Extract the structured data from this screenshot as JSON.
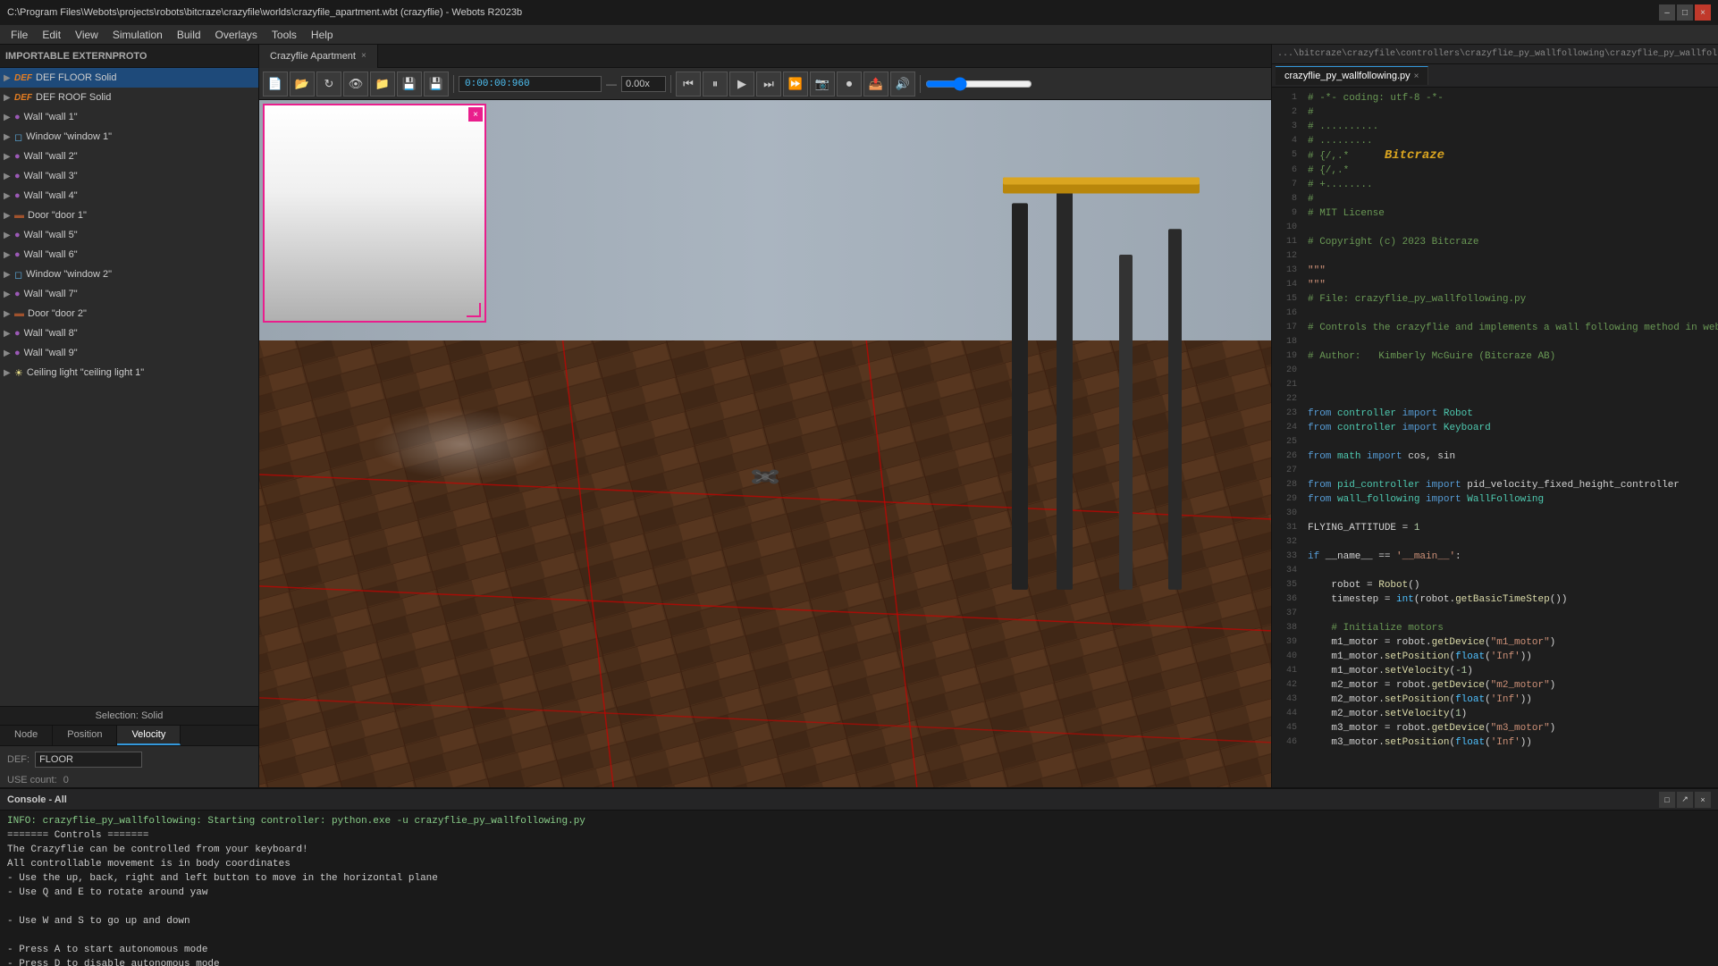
{
  "window": {
    "title": "C:\\Program Files\\Webots\\projects\\robots\\bitcraze\\crazyfile\\worlds\\crazyfile_apartment.wbt (crazyflie) - Webots R2023b"
  },
  "menu": {
    "items": [
      "File",
      "Edit",
      "View",
      "Simulation",
      "Build",
      "Overlays",
      "Tools",
      "Help"
    ]
  },
  "world_tab": {
    "label": "Crazyflie Apartment",
    "close_btn": "×"
  },
  "toolbar": {
    "time": "0:00:00:960",
    "separator": "—",
    "speed": "0.00x"
  },
  "scene_tree": {
    "header": "IMPORTABLE EXTERNPROTO",
    "items": [
      {
        "label": "DEF FLOOR Solid",
        "type": "def",
        "expanded": false
      },
      {
        "label": "DEF ROOF Solid",
        "type": "def",
        "expanded": false
      },
      {
        "label": "Wall \"wall 1\"",
        "type": "wall",
        "expanded": false
      },
      {
        "label": "Window \"window 1\"",
        "type": "window",
        "expanded": false
      },
      {
        "label": "Wall \"wall 2\"",
        "type": "wall",
        "expanded": false
      },
      {
        "label": "Wall \"wall 3\"",
        "type": "wall",
        "expanded": false
      },
      {
        "label": "Wall \"wall 4\"",
        "type": "wall",
        "expanded": false
      },
      {
        "label": "Door \"door 1\"",
        "type": "door",
        "expanded": false
      },
      {
        "label": "Wall \"wall 5\"",
        "type": "wall",
        "expanded": false
      },
      {
        "label": "Wall \"wall 6\"",
        "type": "wall",
        "expanded": false
      },
      {
        "label": "Window \"window 2\"",
        "type": "window",
        "expanded": false
      },
      {
        "label": "Wall \"wall 7\"",
        "type": "wall",
        "expanded": false
      },
      {
        "label": "Door \"door 2\"",
        "type": "door",
        "expanded": false
      },
      {
        "label": "Wall \"wall 8\"",
        "type": "wall",
        "expanded": false
      },
      {
        "label": "Wall \"wall 9\"",
        "type": "wall",
        "expanded": false
      },
      {
        "label": "Ceiling light \"ceiling light 1\"",
        "type": "ceiling",
        "expanded": false
      }
    ],
    "selected_index": 0
  },
  "selection_bar": {
    "text": "Selection: Solid"
  },
  "tabs": {
    "items": [
      "Node",
      "Position",
      "Velocity"
    ],
    "active": 2
  },
  "def_field": {
    "label": "DEF:",
    "value": "FLOOR",
    "use_count_label": "USE count:",
    "use_count_value": "0"
  },
  "editor": {
    "tab_label": "crazyflie_py_wallfollowing.py",
    "close_btn": "×",
    "path": "...\\bitcraze\\crazyfile\\controllers\\crazyflie_py_wallfollowing\\crazyflie_py_wallfollowing.py",
    "code_lines": [
      {
        "num": 1,
        "content": "# -*- coding: utf-8 -*-",
        "class": "kw-comment"
      },
      {
        "num": 2,
        "content": "#",
        "class": "kw-comment"
      },
      {
        "num": 3,
        "content": "# ..........",
        "class": "kw-comment"
      },
      {
        "num": 4,
        "content": "# .........",
        "class": "kw-comment"
      },
      {
        "num": 5,
        "content": "# {/,.*      Bitcraze",
        "class": "kw-comment"
      },
      {
        "num": 6,
        "content": "# {/,.*",
        "class": "kw-comment"
      },
      {
        "num": 7,
        "content": "# +........",
        "class": "kw-comment"
      },
      {
        "num": 8,
        "content": "#",
        "class": "kw-comment"
      },
      {
        "num": 9,
        "content": "# MIT License",
        "class": "kw-comment"
      },
      {
        "num": 10,
        "content": "",
        "class": ""
      },
      {
        "num": 11,
        "content": "# Copyright (c) 2023 Bitcraze",
        "class": "kw-comment"
      },
      {
        "num": 12,
        "content": "",
        "class": ""
      },
      {
        "num": 13,
        "content": "\"\"\"",
        "class": "kw-string"
      },
      {
        "num": 14,
        "content": "\"\"\"",
        "class": "kw-string"
      },
      {
        "num": 15,
        "content": "# File: crazyflie_py_wallfollowing.py",
        "class": "kw-comment"
      },
      {
        "num": 16,
        "content": "",
        "class": ""
      },
      {
        "num": 17,
        "content": "# Controls the crazyflie and implements a wall following method in webots in",
        "class": "kw-comment"
      },
      {
        "num": 18,
        "content": "",
        "class": ""
      },
      {
        "num": 19,
        "content": "# Author:   Kimberly McGuire (Bitcraze AB)",
        "class": "kw-comment"
      },
      {
        "num": 20,
        "content": "",
        "class": ""
      },
      {
        "num": 21,
        "content": "",
        "class": ""
      },
      {
        "num": 22,
        "content": "",
        "class": ""
      },
      {
        "num": 23,
        "content": "from controller import Robot",
        "class": ""
      },
      {
        "num": 24,
        "content": "from controller import Keyboard",
        "class": ""
      },
      {
        "num": 25,
        "content": "",
        "class": ""
      },
      {
        "num": 26,
        "content": "from math import cos, sin",
        "class": ""
      },
      {
        "num": 27,
        "content": "",
        "class": ""
      },
      {
        "num": 28,
        "content": "from pid_controller import pid_velocity_fixed_height_controller",
        "class": ""
      },
      {
        "num": 29,
        "content": "from wall_following import WallFollowing",
        "class": ""
      },
      {
        "num": 30,
        "content": "",
        "class": ""
      },
      {
        "num": 31,
        "content": "FLYING_ATTITUDE = 1",
        "class": ""
      },
      {
        "num": 32,
        "content": "",
        "class": ""
      },
      {
        "num": 33,
        "content": "if __name__ == '__main__':",
        "class": ""
      },
      {
        "num": 34,
        "content": "",
        "class": ""
      },
      {
        "num": 35,
        "content": "    robot = Robot()",
        "class": ""
      },
      {
        "num": 36,
        "content": "    timestep = int(robot.getBasicTimeStep())",
        "class": ""
      },
      {
        "num": 37,
        "content": "",
        "class": ""
      },
      {
        "num": 38,
        "content": "    # Initialize motors",
        "class": "kw-comment"
      },
      {
        "num": 39,
        "content": "    m1_motor = robot.getDevice(\"m1_motor\")",
        "class": ""
      },
      {
        "num": 40,
        "content": "    m1_motor.setPosition(float('Inf'))",
        "class": ""
      },
      {
        "num": 41,
        "content": "    m1_motor.setVelocity(-1)",
        "class": ""
      },
      {
        "num": 42,
        "content": "    m2_motor = robot.getDevice(\"m2_motor\")",
        "class": ""
      },
      {
        "num": 43,
        "content": "    m2_motor.setPosition(float('Inf'))",
        "class": ""
      },
      {
        "num": 44,
        "content": "    m2_motor.setVelocity(1)",
        "class": ""
      },
      {
        "num": 45,
        "content": "    m3_motor = robot.getDevice(\"m3_motor\")",
        "class": ""
      },
      {
        "num": 46,
        "content": "    m3_motor.setPosition(float('Inf'))",
        "class": ""
      }
    ]
  },
  "console": {
    "title": "Console - All",
    "lines": [
      {
        "text": "INFO: crazyflie_py_wallfollowing: Starting controller: python.exe -u crazyflie_py_wallfollowing.py",
        "class": "console-info"
      },
      {
        "text": "======= Controls =======",
        "class": "console-text"
      },
      {
        "text": "The Crazyflie can be controlled from your keyboard!",
        "class": "console-text"
      },
      {
        "text": "All controllable movement is in body coordinates",
        "class": "console-text"
      },
      {
        "text": "- Use the up, back, right and left button to move in the horizontal plane",
        "class": "console-text"
      },
      {
        "text": "- Use Q and E to rotate around yaw",
        "class": "console-text"
      },
      {
        "text": "",
        "class": "console-text"
      },
      {
        "text": "- Use W and S to go up and down",
        "class": "console-text"
      },
      {
        "text": "",
        "class": "console-text"
      },
      {
        "text": "- Press A to start autonomous mode",
        "class": "console-text"
      },
      {
        "text": "- Press D to disable autonomous mode",
        "class": "console-text"
      }
    ]
  },
  "icons": {
    "arrow_right": "▶",
    "arrow_down": "▼",
    "close": "×",
    "maximize": "□",
    "minimize": "–",
    "play": "▶",
    "pause": "⏸",
    "step": "⏭",
    "stop": "⏹",
    "record": "⏺",
    "rewind": "⏮",
    "fast_forward": "⏩",
    "camera": "📷",
    "folder_open": "📂",
    "save": "💾",
    "refresh": "↻",
    "new_file": "📄"
  }
}
